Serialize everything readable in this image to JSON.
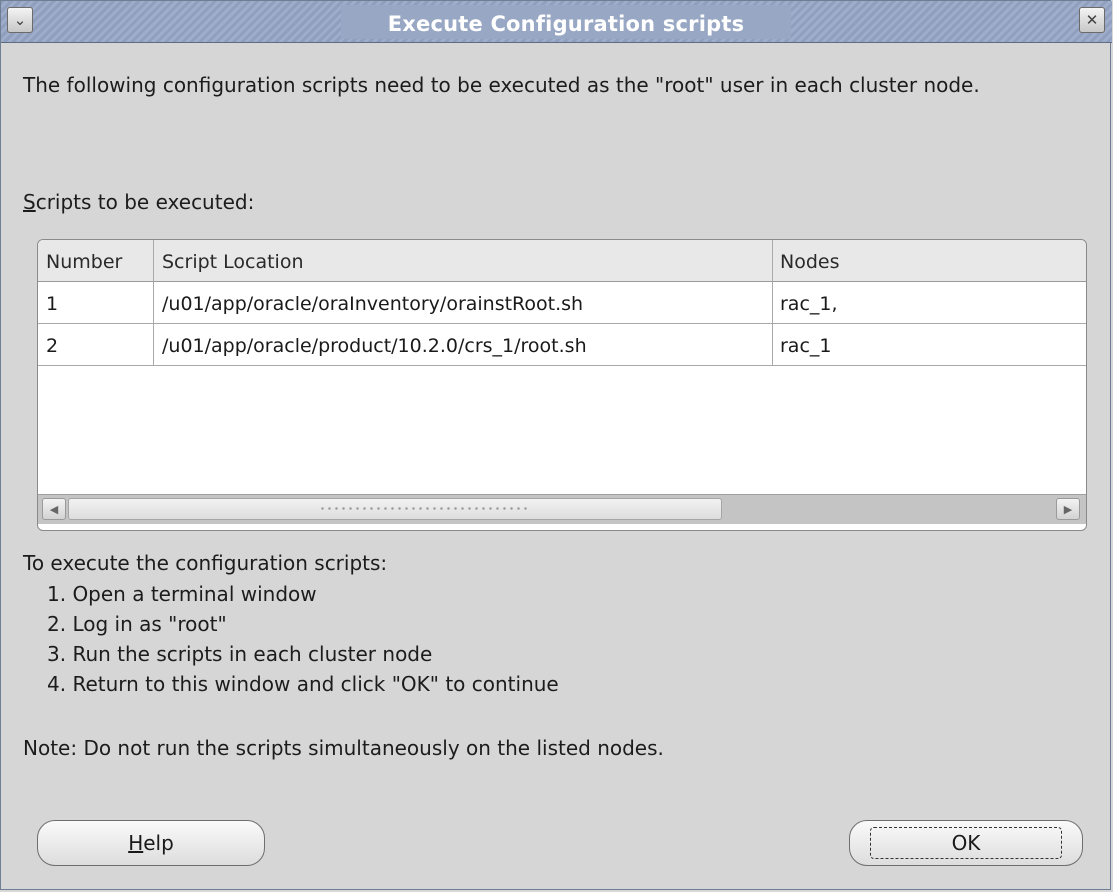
{
  "window": {
    "title": "Execute Configuration scripts",
    "menu_icon": "chevron-down-icon",
    "close_icon": "close-icon"
  },
  "intro_text": "The following configuration scripts need to be executed as the \"root\" user in each cluster node.",
  "scripts_label_mnemonic": "S",
  "scripts_label_rest": "cripts to be executed:",
  "table": {
    "headers": [
      "Number",
      "Script Location",
      "Nodes"
    ],
    "rows": [
      [
        "1",
        "/u01/app/oracle/oraInventory/orainstRoot.sh",
        "rac_1,"
      ],
      [
        "2",
        "/u01/app/oracle/product/10.2.0/crs_1/root.sh",
        "rac_1"
      ]
    ]
  },
  "instructions": {
    "heading": "To execute the configuration scripts:",
    "steps": [
      "1. Open a terminal window",
      "2. Log in as \"root\"",
      "3. Run the scripts in each cluster node",
      "4. Return to this window and click \"OK\" to continue"
    ]
  },
  "note": "Note: Do not run the scripts simultaneously on the listed nodes.",
  "buttons": {
    "help_mnemonic": "H",
    "help_rest": "elp",
    "ok": "OK"
  },
  "colors": {
    "titlebar": "#98a7c3",
    "window_bg": "#d6d6d6"
  }
}
